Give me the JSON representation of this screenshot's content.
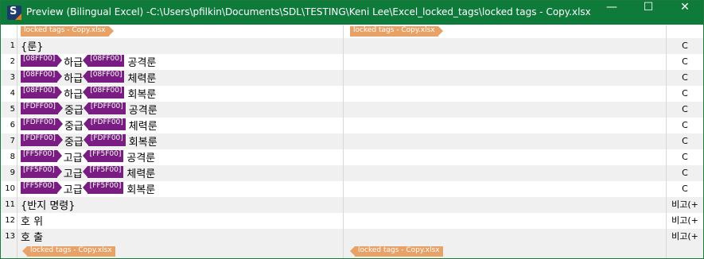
{
  "window": {
    "title": "Preview (Bilingual Excel) -C:\\Users\\pfilkin\\Documents\\SDL\\TESTING\\Keni Lee\\Excel_locked_tags\\locked tags - Copy.xlsx",
    "icon_letter": "S",
    "minimize_glyph": "—",
    "maximize_glyph": "☐",
    "close_glyph": "✕"
  },
  "file_tag": {
    "label": "locked tags - Copy.xlsx",
    "color": "#e8a267"
  },
  "inline_tag_color": "#7a1d82",
  "rows": [
    {
      "num": "1",
      "text": "{룬}",
      "status": "C"
    },
    {
      "num": "2",
      "tag1": "[08FF00]",
      "word1": "하급",
      "tag2": "[08FF00]",
      "word2": "공격룬",
      "status": "C"
    },
    {
      "num": "3",
      "tag1": "[08FF00]",
      "word1": "하급",
      "tag2": "[08FF00]",
      "word2": "체력룬",
      "status": "C"
    },
    {
      "num": "4",
      "tag1": "[08FF00]",
      "word1": "하급",
      "tag2": "[08FF00]",
      "word2": "회복룬",
      "status": "C"
    },
    {
      "num": "5",
      "tag1": "[FDFF00]",
      "word1": "중급",
      "tag2": "[FDFF00]",
      "word2": "공격룬",
      "status": "C"
    },
    {
      "num": "6",
      "tag1": "[FDFF00]",
      "word1": "중급",
      "tag2": "[FDFF00]",
      "word2": "체력룬",
      "status": "C"
    },
    {
      "num": "7",
      "tag1": "[FDFF00]",
      "word1": "중급",
      "tag2": "[FDFF00]",
      "word2": "회복룬",
      "status": "C"
    },
    {
      "num": "8",
      "tag1": "[FF5F00]",
      "word1": "고급",
      "tag2": "[FF5F00]",
      "word2": "공격룬",
      "status": "C"
    },
    {
      "num": "9",
      "tag1": "[FF5F00]",
      "word1": "고급",
      "tag2": "[FF5F00]",
      "word2": "체력룬",
      "status": "C"
    },
    {
      "num": "10",
      "tag1": "[FF5F00]",
      "word1": "고급",
      "tag2": "[FF5F00]",
      "word2": "회복룬",
      "status": "C"
    },
    {
      "num": "11",
      "text": "{반지 명령}",
      "status": "비고(+"
    },
    {
      "num": "12",
      "text": "호 위",
      "status": "비고(+"
    },
    {
      "num": "13",
      "text": "호 출",
      "status": "비고(+"
    }
  ]
}
